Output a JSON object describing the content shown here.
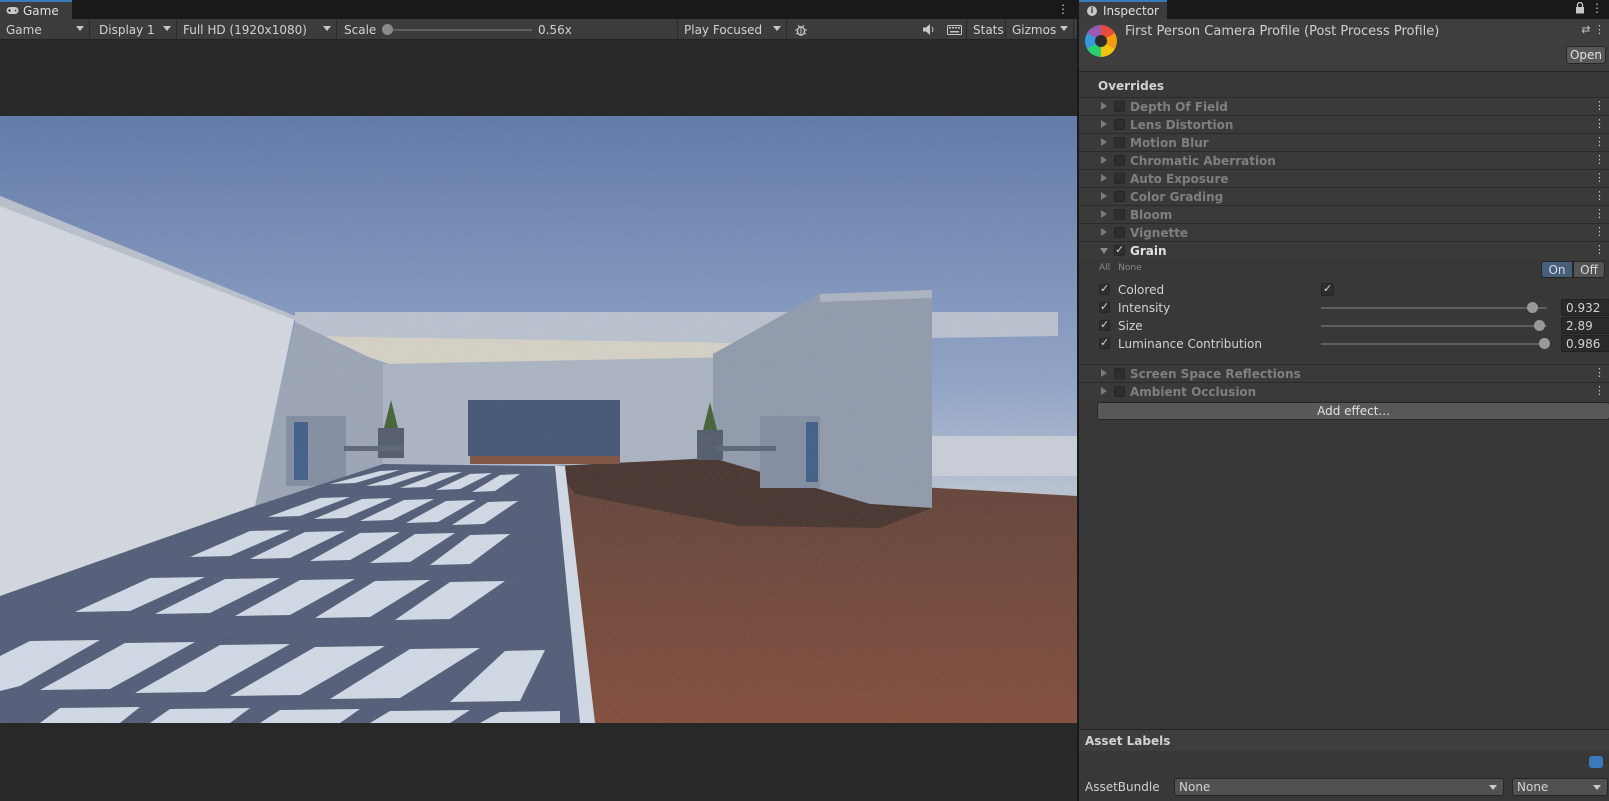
{
  "game": {
    "tab_label": "Game",
    "toolbar": {
      "view_mode": "Game",
      "display": "Display 1",
      "resolution": "Full HD (1920x1080)",
      "scale_label": "Scale",
      "scale_value": "0.56x",
      "scale_fraction": 0.0,
      "play_mode": "Play Focused",
      "stats_label": "Stats",
      "gizmos_label": "Gizmos"
    }
  },
  "inspector": {
    "tab_label": "Inspector",
    "title": "First Person Camera Profile (Post Process Profile)",
    "open_label": "Open",
    "overrides_label": "Overrides",
    "effects_before": [
      {
        "name": "Depth Of Field",
        "enabled": false
      },
      {
        "name": "Lens Distortion",
        "enabled": false
      },
      {
        "name": "Motion Blur",
        "enabled": false
      },
      {
        "name": "Chromatic Aberration",
        "enabled": false
      },
      {
        "name": "Auto Exposure",
        "enabled": false
      },
      {
        "name": "Color Grading",
        "enabled": false
      },
      {
        "name": "Bloom",
        "enabled": false
      },
      {
        "name": "Vignette",
        "enabled": false
      }
    ],
    "grain": {
      "name": "Grain",
      "enabled": true,
      "all_label": "All",
      "none_label": "None",
      "on_label": "On",
      "off_label": "Off",
      "props": {
        "colored": {
          "label": "Colored",
          "checked": true
        },
        "intensity": {
          "label": "Intensity",
          "value": "0.932",
          "fraction": 0.932
        },
        "size": {
          "label": "Size",
          "value": "2.89",
          "fraction": 0.963
        },
        "luminance": {
          "label": "Luminance Contribution",
          "value": "0.986",
          "fraction": 0.986
        }
      }
    },
    "effects_after": [
      {
        "name": "Screen Space Reflections",
        "enabled": false
      },
      {
        "name": "Ambient Occlusion",
        "enabled": false
      }
    ],
    "add_effect_label": "Add effect...",
    "asset_labels_title": "Asset Labels",
    "assetbundle_label": "AssetBundle",
    "assetbundle_value": "None",
    "assetbundle_variant": "None"
  }
}
